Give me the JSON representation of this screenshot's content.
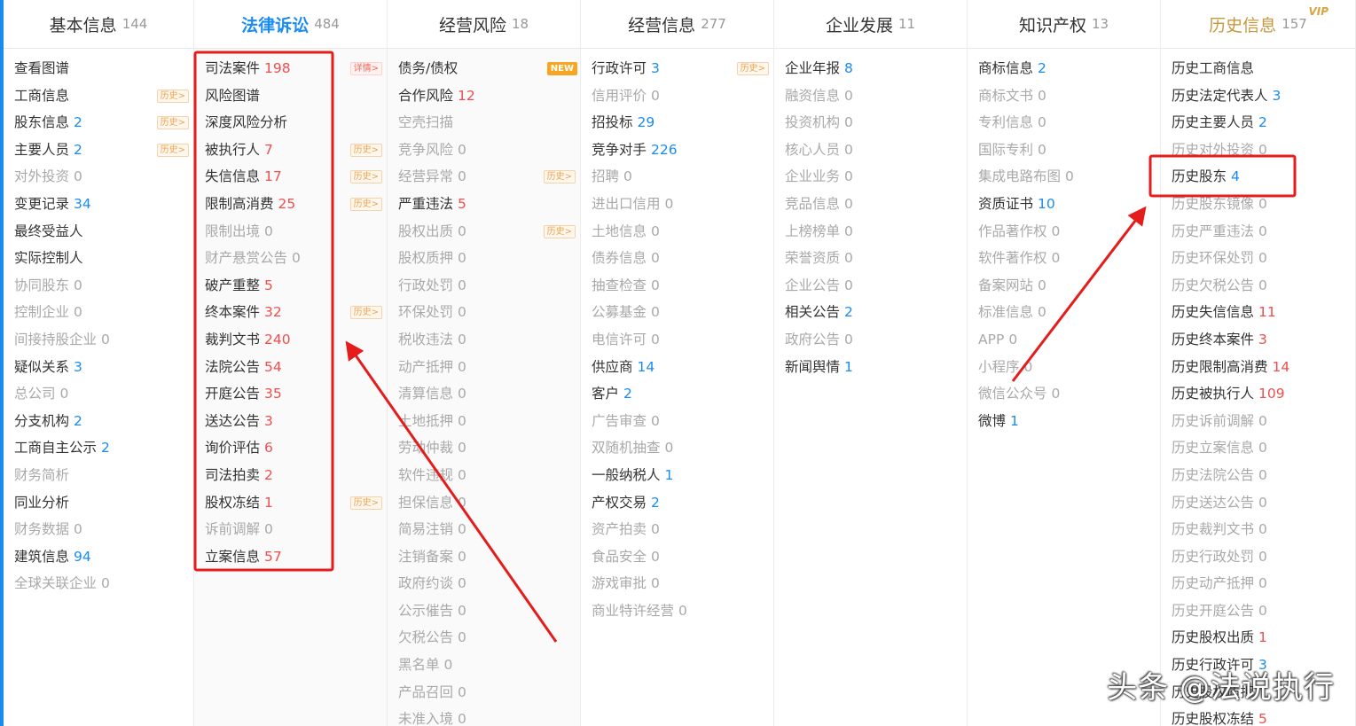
{
  "accent_color": "#1a8cf0",
  "annotation_color": "#e51c1c",
  "columns": [
    {
      "title": "基本信息",
      "count": "144",
      "items": [
        {
          "label": "查看图谱",
          "num": "",
          "tag": ""
        },
        {
          "label": "工商信息",
          "num": "",
          "tag": "历史>"
        },
        {
          "label": "股东信息",
          "num": "2",
          "tag": "历史>"
        },
        {
          "label": "主要人员",
          "num": "2",
          "tag": "历史>"
        },
        {
          "label": "对外投资",
          "num": "0",
          "tag": ""
        },
        {
          "label": "变更记录",
          "num": "34",
          "tag": ""
        },
        {
          "label": "最终受益人",
          "num": "",
          "tag": ""
        },
        {
          "label": "实际控制人",
          "num": "",
          "tag": ""
        },
        {
          "label": "协同股东",
          "num": "0",
          "tag": ""
        },
        {
          "label": "控制企业",
          "num": "0",
          "tag": ""
        },
        {
          "label": "间接持股企业",
          "num": "0",
          "tag": ""
        },
        {
          "label": "疑似关系",
          "num": "3",
          "tag": ""
        },
        {
          "label": "总公司",
          "num": "0",
          "tag": ""
        },
        {
          "label": "分支机构",
          "num": "2",
          "tag": ""
        },
        {
          "label": "工商自主公示",
          "num": "2",
          "tag": ""
        },
        {
          "label": "财务简析",
          "num": "",
          "tag": "",
          "dim": true
        },
        {
          "label": "同业分析",
          "num": "",
          "tag": ""
        },
        {
          "label": "财务数据",
          "num": "0",
          "tag": ""
        },
        {
          "label": "建筑信息",
          "num": "94",
          "tag": ""
        },
        {
          "label": "全球关联企业",
          "num": "0",
          "tag": ""
        }
      ]
    },
    {
      "title": "法律诉讼",
      "count": "484",
      "items": [
        {
          "label": "司法案件",
          "num": "198",
          "tag": "详情>",
          "tagtype": "detail"
        },
        {
          "label": "风险图谱",
          "num": "",
          "tag": ""
        },
        {
          "label": "深度风险分析",
          "num": "",
          "tag": ""
        },
        {
          "label": "被执行人",
          "num": "7",
          "tag": "历史>"
        },
        {
          "label": "失信信息",
          "num": "17",
          "tag": "历史>"
        },
        {
          "label": "限制高消费",
          "num": "25",
          "tag": "历史>"
        },
        {
          "label": "限制出境",
          "num": "0",
          "tag": ""
        },
        {
          "label": "财产悬赏公告",
          "num": "0",
          "tag": ""
        },
        {
          "label": "破产重整",
          "num": "5",
          "tag": ""
        },
        {
          "label": "终本案件",
          "num": "32",
          "tag": "历史>"
        },
        {
          "label": "裁判文书",
          "num": "240",
          "tag": ""
        },
        {
          "label": "法院公告",
          "num": "54",
          "tag": ""
        },
        {
          "label": "开庭公告",
          "num": "35",
          "tag": ""
        },
        {
          "label": "送达公告",
          "num": "3",
          "tag": ""
        },
        {
          "label": "询价评估",
          "num": "6",
          "tag": ""
        },
        {
          "label": "司法拍卖",
          "num": "2",
          "tag": ""
        },
        {
          "label": "股权冻结",
          "num": "1",
          "tag": "历史>"
        },
        {
          "label": "诉前调解",
          "num": "0",
          "tag": ""
        },
        {
          "label": "立案信息",
          "num": "57",
          "tag": ""
        }
      ]
    },
    {
      "title": "经营风险",
      "count": "18",
      "items": [
        {
          "label": "债务/债权",
          "num": "",
          "tag": "NEW",
          "tagtype": "new"
        },
        {
          "label": "合作风险",
          "num": "12",
          "tag": ""
        },
        {
          "label": "空壳扫描",
          "num": "",
          "tag": "",
          "dim": true
        },
        {
          "label": "竞争风险",
          "num": "0",
          "tag": ""
        },
        {
          "label": "经营异常",
          "num": "0",
          "tag": "历史>"
        },
        {
          "label": "严重违法",
          "num": "5",
          "tag": ""
        },
        {
          "label": "股权出质",
          "num": "0",
          "tag": "历史>"
        },
        {
          "label": "股权质押",
          "num": "0",
          "tag": ""
        },
        {
          "label": "行政处罚",
          "num": "0",
          "tag": ""
        },
        {
          "label": "环保处罚",
          "num": "0",
          "tag": ""
        },
        {
          "label": "税收违法",
          "num": "0",
          "tag": ""
        },
        {
          "label": "动产抵押",
          "num": "0",
          "tag": ""
        },
        {
          "label": "清算信息",
          "num": "0",
          "tag": ""
        },
        {
          "label": "土地抵押",
          "num": "0",
          "tag": ""
        },
        {
          "label": "劳动仲裁",
          "num": "0",
          "tag": ""
        },
        {
          "label": "软件违规",
          "num": "0",
          "tag": ""
        },
        {
          "label": "担保信息",
          "num": "0",
          "tag": ""
        },
        {
          "label": "简易注销",
          "num": "0",
          "tag": ""
        },
        {
          "label": "注销备案",
          "num": "0",
          "tag": ""
        },
        {
          "label": "政府约谈",
          "num": "0",
          "tag": ""
        },
        {
          "label": "公示催告",
          "num": "0",
          "tag": ""
        },
        {
          "label": "欠税公告",
          "num": "0",
          "tag": ""
        },
        {
          "label": "黑名单",
          "num": "0",
          "tag": ""
        },
        {
          "label": "产品召回",
          "num": "0",
          "tag": ""
        },
        {
          "label": "未准入境",
          "num": "0",
          "tag": ""
        }
      ]
    },
    {
      "title": "经营信息",
      "count": "277",
      "items": [
        {
          "label": "行政许可",
          "num": "3",
          "tag": "历史>"
        },
        {
          "label": "信用评价",
          "num": "0",
          "tag": ""
        },
        {
          "label": "招投标",
          "num": "29",
          "tag": ""
        },
        {
          "label": "竞争对手",
          "num": "226",
          "tag": ""
        },
        {
          "label": "招聘",
          "num": "0",
          "tag": ""
        },
        {
          "label": "进出口信用",
          "num": "0",
          "tag": ""
        },
        {
          "label": "土地信息",
          "num": "0",
          "tag": ""
        },
        {
          "label": "债券信息",
          "num": "0",
          "tag": ""
        },
        {
          "label": "抽查检查",
          "num": "0",
          "tag": ""
        },
        {
          "label": "公募基金",
          "num": "0",
          "tag": ""
        },
        {
          "label": "电信许可",
          "num": "0",
          "tag": ""
        },
        {
          "label": "供应商",
          "num": "14",
          "tag": ""
        },
        {
          "label": "客户",
          "num": "2",
          "tag": ""
        },
        {
          "label": "广告审查",
          "num": "0",
          "tag": ""
        },
        {
          "label": "双随机抽查",
          "num": "0",
          "tag": ""
        },
        {
          "label": "一般纳税人",
          "num": "1",
          "tag": ""
        },
        {
          "label": "产权交易",
          "num": "2",
          "tag": ""
        },
        {
          "label": "资产拍卖",
          "num": "0",
          "tag": ""
        },
        {
          "label": "食品安全",
          "num": "0",
          "tag": ""
        },
        {
          "label": "游戏审批",
          "num": "0",
          "tag": ""
        },
        {
          "label": "商业特许经营",
          "num": "0",
          "tag": ""
        }
      ]
    },
    {
      "title": "企业发展",
      "count": "11",
      "items": [
        {
          "label": "企业年报",
          "num": "8",
          "tag": ""
        },
        {
          "label": "融资信息",
          "num": "0",
          "tag": ""
        },
        {
          "label": "投资机构",
          "num": "0",
          "tag": ""
        },
        {
          "label": "核心人员",
          "num": "0",
          "tag": ""
        },
        {
          "label": "企业业务",
          "num": "0",
          "tag": ""
        },
        {
          "label": "竞品信息",
          "num": "0",
          "tag": ""
        },
        {
          "label": "上榜榜单",
          "num": "0",
          "tag": ""
        },
        {
          "label": "荣誉资质",
          "num": "0",
          "tag": ""
        },
        {
          "label": "企业公告",
          "num": "0",
          "tag": ""
        },
        {
          "label": "相关公告",
          "num": "2",
          "tag": ""
        },
        {
          "label": "政府公告",
          "num": "0",
          "tag": ""
        },
        {
          "label": "新闻舆情",
          "num": "1",
          "tag": ""
        }
      ]
    },
    {
      "title": "知识产权",
      "count": "13",
      "items": [
        {
          "label": "商标信息",
          "num": "2",
          "tag": ""
        },
        {
          "label": "商标文书",
          "num": "0",
          "tag": ""
        },
        {
          "label": "专利信息",
          "num": "0",
          "tag": ""
        },
        {
          "label": "国际专利",
          "num": "0",
          "tag": ""
        },
        {
          "label": "集成电路布图",
          "num": "0",
          "tag": ""
        },
        {
          "label": "资质证书",
          "num": "10",
          "tag": ""
        },
        {
          "label": "作品著作权",
          "num": "0",
          "tag": ""
        },
        {
          "label": "软件著作权",
          "num": "0",
          "tag": ""
        },
        {
          "label": "备案网站",
          "num": "0",
          "tag": ""
        },
        {
          "label": "标准信息",
          "num": "0",
          "tag": ""
        },
        {
          "label": "APP",
          "num": "0",
          "tag": ""
        },
        {
          "label": "小程序",
          "num": "0",
          "tag": ""
        },
        {
          "label": "微信公众号",
          "num": "0",
          "tag": ""
        },
        {
          "label": "微博",
          "num": "1",
          "tag": ""
        }
      ]
    },
    {
      "title": "历史信息",
      "count": "157",
      "vip": "VIP",
      "items": [
        {
          "label": "历史工商信息",
          "num": "",
          "tag": ""
        },
        {
          "label": "历史法定代表人",
          "num": "3",
          "tag": ""
        },
        {
          "label": "历史主要人员",
          "num": "2",
          "tag": ""
        },
        {
          "label": "历史对外投资",
          "num": "0",
          "tag": ""
        },
        {
          "label": "历史股东",
          "num": "4",
          "tag": ""
        },
        {
          "label": "历史股东镜像",
          "num": "0",
          "tag": ""
        },
        {
          "label": "历史严重违法",
          "num": "0",
          "tag": ""
        },
        {
          "label": "历史环保处罚",
          "num": "0",
          "tag": ""
        },
        {
          "label": "历史欠税公告",
          "num": "0",
          "tag": ""
        },
        {
          "label": "历史失信信息",
          "num": "11",
          "tag": ""
        },
        {
          "label": "历史终本案件",
          "num": "3",
          "tag": ""
        },
        {
          "label": "历史限制高消费",
          "num": "14",
          "tag": ""
        },
        {
          "label": "历史被执行人",
          "num": "109",
          "tag": ""
        },
        {
          "label": "历史诉前调解",
          "num": "0",
          "tag": ""
        },
        {
          "label": "历史立案信息",
          "num": "0",
          "tag": ""
        },
        {
          "label": "历史法院公告",
          "num": "0",
          "tag": ""
        },
        {
          "label": "历史送达公告",
          "num": "0",
          "tag": ""
        },
        {
          "label": "历史裁判文书",
          "num": "0",
          "tag": ""
        },
        {
          "label": "历史行政处罚",
          "num": "0",
          "tag": ""
        },
        {
          "label": "历史动产抵押",
          "num": "0",
          "tag": ""
        },
        {
          "label": "历史开庭公告",
          "num": "0",
          "tag": ""
        },
        {
          "label": "历史股权出质",
          "num": "1",
          "tag": ""
        },
        {
          "label": "历史行政许可",
          "num": "3",
          "tag": ""
        },
        {
          "label": "历史股权质押",
          "num": "",
          "tag": ""
        },
        {
          "label": "历史股权冻结",
          "num": "5",
          "tag": ""
        }
      ]
    }
  ],
  "watermark": "头条 @法说执行"
}
